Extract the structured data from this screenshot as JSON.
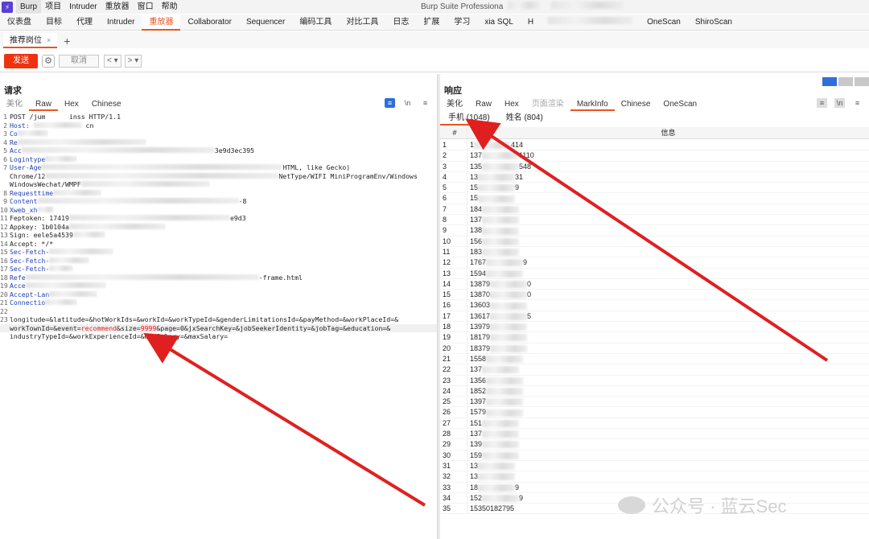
{
  "menubar": {
    "logo": "⚡",
    "items": [
      "Burp",
      "项目",
      "Intruder",
      "重放器",
      "窗口",
      "帮助"
    ],
    "title": "Burp Suite Professiona"
  },
  "tool_tabs": [
    "仪表盘",
    "目标",
    "代理",
    "Intruder",
    "重放器",
    "Collaborator",
    "Sequencer",
    "编码工具",
    "对比工具",
    "日志",
    "扩展",
    "学习",
    "xia SQL",
    "H",
    "",
    "OneScan",
    "ShiroScan"
  ],
  "active_tool_tab": 4,
  "repeater_tab": {
    "label": "推荐岗位",
    "close": "×",
    "add": "+"
  },
  "actions": {
    "send": "发送",
    "cancel": "取消",
    "prev": "<",
    "prev_dd": "▾",
    "next": ">",
    "next_dd": "▾",
    "gear": "⚙"
  },
  "request": {
    "title": "请求",
    "tabs": [
      "美化",
      "Raw",
      "Hex",
      "Chinese"
    ],
    "active_tab": 1,
    "icons": [
      "≡",
      "\\n",
      "≡"
    ],
    "lines": [
      {
        "n": "1",
        "t": "POST /jum      inss HTTP/1.1"
      },
      {
        "n": "2",
        "t": "Host: "
      },
      {
        "n": "3",
        "t": "Co"
      },
      {
        "n": "4",
        "t": "Re"
      },
      {
        "n": "5",
        "t": "Acc"
      },
      {
        "n": "6",
        "t": "Logintype"
      },
      {
        "n": "7",
        "t": "User-Age"
      },
      {
        "n": "",
        "t": "Chrome/12"
      },
      {
        "n": "",
        "t": "WindowsWechat/WMPF"
      },
      {
        "n": "8",
        "t": "Requesttime"
      },
      {
        "n": "9",
        "t": "Content"
      },
      {
        "n": "10",
        "t": "Xweb_xh"
      },
      {
        "n": "11",
        "t": "Feptoken: 17419"
      },
      {
        "n": "12",
        "t": "Appkey: 1b0104a"
      },
      {
        "n": "13",
        "t": "Sign: eele5a4539"
      },
      {
        "n": "14",
        "t": "Accept: */*"
      },
      {
        "n": "15",
        "t": "Sec-Fetch-"
      },
      {
        "n": "16",
        "t": "Sec-Fetch-"
      },
      {
        "n": "17",
        "t": "Sec-Fetch-"
      },
      {
        "n": "18",
        "t": "Refe"
      },
      {
        "n": "19",
        "t": "Acce"
      },
      {
        "n": "20",
        "t": "Accept-Lan"
      },
      {
        "n": "21",
        "t": "Connectio"
      },
      {
        "n": "22",
        "t": ""
      },
      {
        "n": "23",
        "t": ""
      }
    ],
    "line_fragments": {
      "host_tail": "cn",
      "acc_tail": "3e9d3ec395",
      "ua_tail": "HTML, like Gecko)",
      "chrome_tail": "NetType/WIFI MiniProgramEnv/Windows",
      "content_tail": "-8",
      "feptoken_tail": "e9d3",
      "refe_tail": "-frame.html"
    },
    "body_lines": [
      "longitude=&latitude=&hotWorkIds=&workId=&workTypeId=&genderLimitationsId=&payMethod=&workPlaceId=&",
      "workTownId=&event=recommend&size=9999&page=0&jxSearchKey=&jobSeekerIdentity=&jobTag=&education=&",
      "industryTypeId=&workExperienceId=&minSalary=&maxSalary="
    ]
  },
  "response": {
    "title": "响应",
    "tabs": [
      "美化",
      "Raw",
      "Hex",
      "页面渲染",
      "MarkInfo",
      "Chinese",
      "OneScan"
    ],
    "active_tab": 4,
    "subtabs": [
      "手机 (1048)",
      "姓名 (804)"
    ],
    "table_headers": [
      "#",
      "信息"
    ],
    "rows": [
      {
        "n": "1",
        "v": "1",
        "s": "414"
      },
      {
        "n": "2",
        "v": "137",
        "s": "1110"
      },
      {
        "n": "3",
        "v": "135",
        "s": "548"
      },
      {
        "n": "4",
        "v": "13",
        "s": "31"
      },
      {
        "n": "5",
        "v": "15",
        "s": "9"
      },
      {
        "n": "6",
        "v": "15",
        "s": ""
      },
      {
        "n": "7",
        "v": "184",
        "s": ""
      },
      {
        "n": "8",
        "v": "137",
        "s": ""
      },
      {
        "n": "9",
        "v": "138",
        "s": ""
      },
      {
        "n": "10",
        "v": "156",
        "s": ""
      },
      {
        "n": "11",
        "v": "183",
        "s": ""
      },
      {
        "n": "12",
        "v": "1767",
        "s": "9"
      },
      {
        "n": "13",
        "v": "1594",
        "s": ""
      },
      {
        "n": "14",
        "v": "13879",
        "s": "0"
      },
      {
        "n": "15",
        "v": "13870",
        "s": "0"
      },
      {
        "n": "16",
        "v": "13603",
        "s": ""
      },
      {
        "n": "17",
        "v": "13617",
        "s": "5"
      },
      {
        "n": "18",
        "v": "13979",
        "s": ""
      },
      {
        "n": "19",
        "v": "18179",
        "s": ""
      },
      {
        "n": "20",
        "v": "18379",
        "s": ""
      },
      {
        "n": "21",
        "v": "1558",
        "s": ""
      },
      {
        "n": "22",
        "v": "137",
        "s": ""
      },
      {
        "n": "23",
        "v": "1356",
        "s": ""
      },
      {
        "n": "24",
        "v": "1852",
        "s": ""
      },
      {
        "n": "25",
        "v": "1397",
        "s": ""
      },
      {
        "n": "26",
        "v": "1579",
        "s": ""
      },
      {
        "n": "27",
        "v": "151",
        "s": ""
      },
      {
        "n": "28",
        "v": "137",
        "s": ""
      },
      {
        "n": "29",
        "v": "139",
        "s": ""
      },
      {
        "n": "30",
        "v": "159",
        "s": ""
      },
      {
        "n": "31",
        "v": "13",
        "s": ""
      },
      {
        "n": "32",
        "v": "13",
        "s": ""
      },
      {
        "n": "33",
        "v": "18",
        "s": "9"
      },
      {
        "n": "34",
        "v": "152",
        "s": "9"
      },
      {
        "n": "35",
        "v": "15350182795",
        "s": ""
      }
    ]
  },
  "watermark": "公众号 · 蓝云Sec",
  "colors": {
    "accent": "#e8551e",
    "send": "#f0320f",
    "arrow": "#e02020",
    "header_blue": "#1f3fb0"
  }
}
